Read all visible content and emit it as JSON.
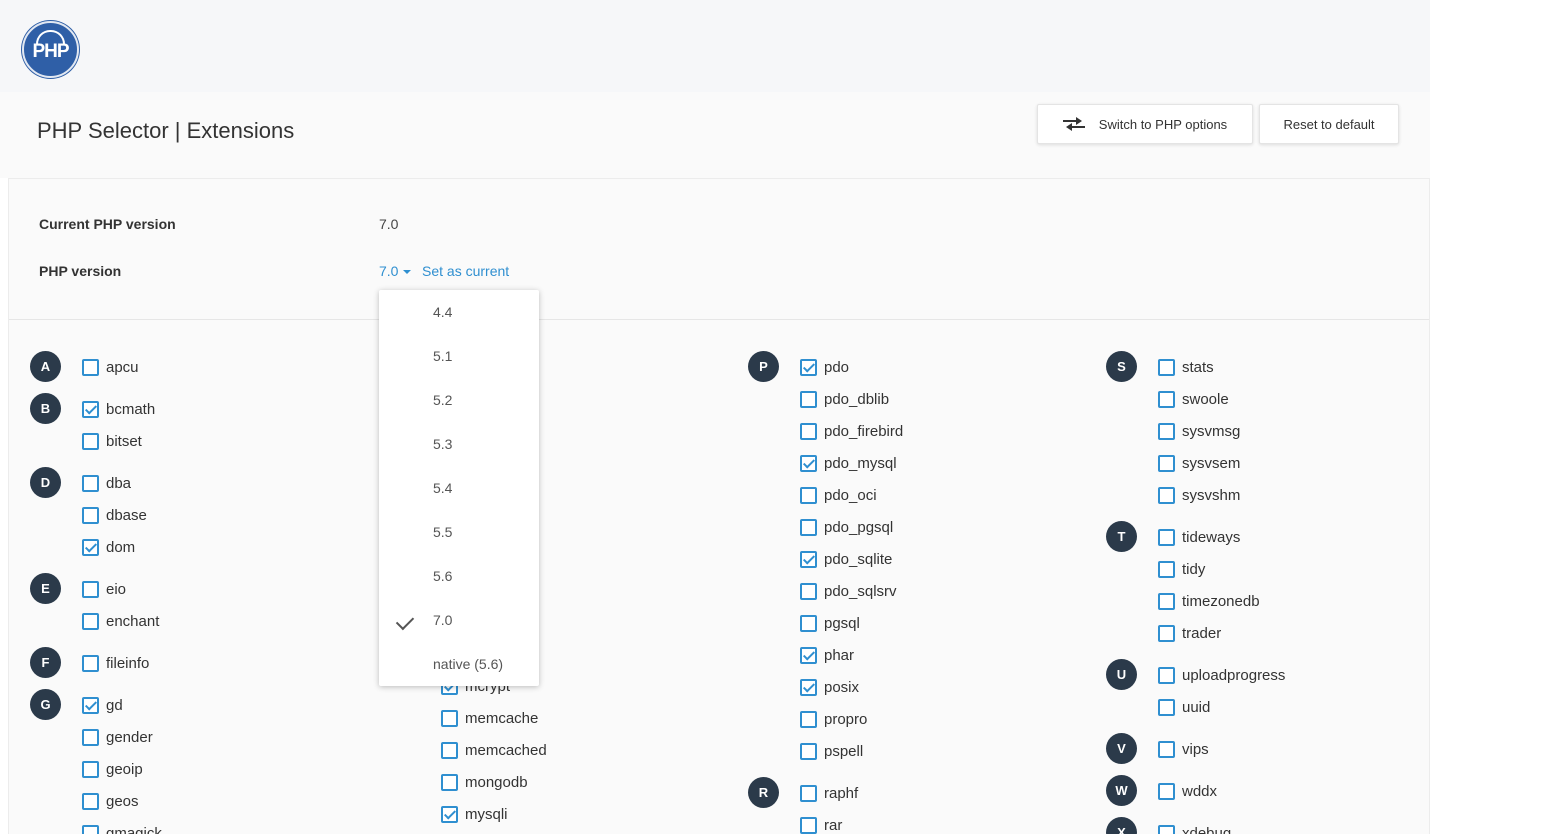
{
  "logo": {
    "text": "PHP"
  },
  "header": {
    "title": "PHP Selector | Extensions",
    "switch_label": "Switch to PHP options",
    "reset_label": "Reset to default"
  },
  "info": {
    "current_label": "Current PHP version",
    "current_value": "7.0",
    "version_label": "PHP version",
    "version_value": "7.0",
    "set_current_label": "Set as current"
  },
  "dropdown": {
    "options": [
      "4.4",
      "5.1",
      "5.2",
      "5.3",
      "5.4",
      "5.5",
      "5.6",
      "7.0",
      "native (5.6)"
    ],
    "selected": "7.0"
  },
  "extensions": [
    {
      "letter": "A",
      "name": "apcu",
      "checked": false
    },
    {
      "letter": "B",
      "name": "bcmath",
      "checked": true
    },
    {
      "letter": "",
      "name": "bitset",
      "checked": false
    },
    {
      "letter": "D",
      "name": "dba",
      "checked": false
    },
    {
      "letter": "",
      "name": "dbase",
      "checked": false
    },
    {
      "letter": "",
      "name": "dom",
      "checked": true
    },
    {
      "letter": "E",
      "name": "eio",
      "checked": false
    },
    {
      "letter": "",
      "name": "enchant",
      "checked": false
    },
    {
      "letter": "F",
      "name": "fileinfo",
      "checked": false
    },
    {
      "letter": "G",
      "name": "gd",
      "checked": true
    },
    {
      "letter": "",
      "name": "gender",
      "checked": false
    },
    {
      "letter": "",
      "name": "geoip",
      "checked": false
    },
    {
      "letter": "",
      "name": "geos",
      "checked": false
    },
    {
      "letter": "",
      "name": "gmagick",
      "checked": false
    },
    {
      "letter": "",
      "name": "mcrypt",
      "checked": true
    },
    {
      "letter": "",
      "name": "memcache",
      "checked": false
    },
    {
      "letter": "",
      "name": "memcached",
      "checked": false
    },
    {
      "letter": "",
      "name": "mongodb",
      "checked": false
    },
    {
      "letter": "",
      "name": "mysqli",
      "checked": true
    },
    {
      "letter": "P",
      "name": "pdo",
      "checked": true
    },
    {
      "letter": "",
      "name": "pdo_dblib",
      "checked": false
    },
    {
      "letter": "",
      "name": "pdo_firebird",
      "checked": false
    },
    {
      "letter": "",
      "name": "pdo_mysql",
      "checked": true
    },
    {
      "letter": "",
      "name": "pdo_oci",
      "checked": false
    },
    {
      "letter": "",
      "name": "pdo_pgsql",
      "checked": false
    },
    {
      "letter": "",
      "name": "pdo_sqlite",
      "checked": true
    },
    {
      "letter": "",
      "name": "pdo_sqlsrv",
      "checked": false
    },
    {
      "letter": "",
      "name": "pgsql",
      "checked": false
    },
    {
      "letter": "",
      "name": "phar",
      "checked": true
    },
    {
      "letter": "",
      "name": "posix",
      "checked": true
    },
    {
      "letter": "",
      "name": "propro",
      "checked": false
    },
    {
      "letter": "",
      "name": "pspell",
      "checked": false
    },
    {
      "letter": "R",
      "name": "raphf",
      "checked": false
    },
    {
      "letter": "",
      "name": "rar",
      "checked": false
    },
    {
      "letter": "S",
      "name": "stats",
      "checked": false
    },
    {
      "letter": "",
      "name": "swoole",
      "checked": false
    },
    {
      "letter": "",
      "name": "sysvmsg",
      "checked": false
    },
    {
      "letter": "",
      "name": "sysvsem",
      "checked": false
    },
    {
      "letter": "",
      "name": "sysvshm",
      "checked": false
    },
    {
      "letter": "T",
      "name": "tideways",
      "checked": false
    },
    {
      "letter": "",
      "name": "tidy",
      "checked": false
    },
    {
      "letter": "",
      "name": "timezonedb",
      "checked": false
    },
    {
      "letter": "",
      "name": "trader",
      "checked": false
    },
    {
      "letter": "U",
      "name": "uploadprogress",
      "checked": false
    },
    {
      "letter": "",
      "name": "uuid",
      "checked": false
    },
    {
      "letter": "V",
      "name": "vips",
      "checked": false
    },
    {
      "letter": "W",
      "name": "wddx",
      "checked": false
    },
    {
      "letter": "X",
      "name": "xdebug",
      "checked": false
    }
  ]
}
